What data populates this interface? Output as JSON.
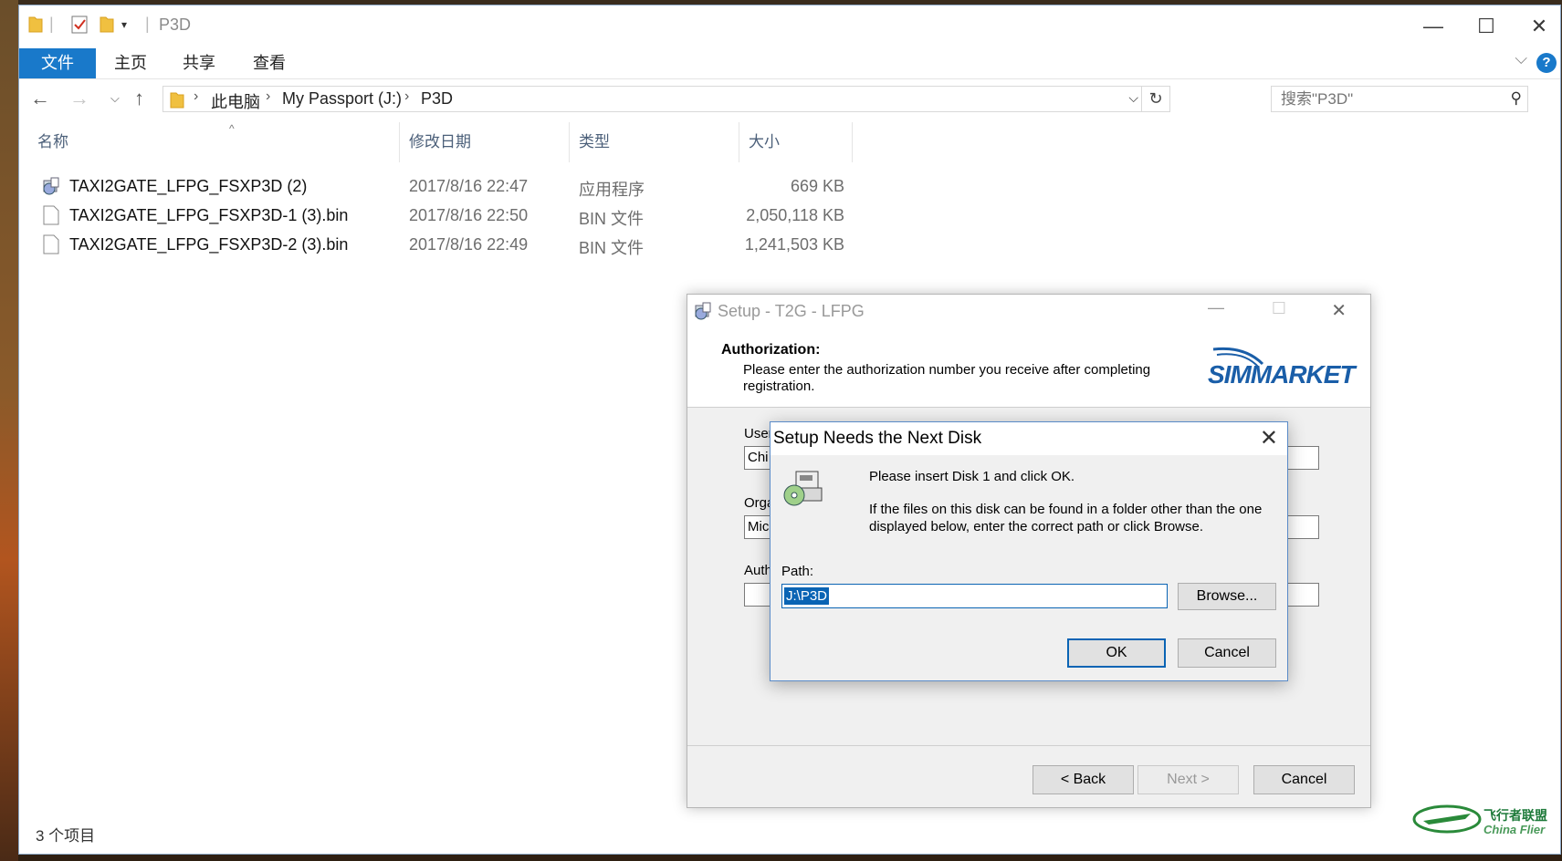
{
  "explorer": {
    "title": "P3D",
    "ribbon_tabs": [
      "文件",
      "主页",
      "共享",
      "查看"
    ],
    "breadcrumb": [
      "此电脑",
      "My Passport (J:)",
      "P3D"
    ],
    "search_placeholder": "搜索\"P3D\"",
    "columns": [
      "名称",
      "修改日期",
      "类型",
      "大小"
    ],
    "files": [
      {
        "name": "TAXI2GATE_LFPG_FSXP3D (2)",
        "date": "2017/8/16 22:47",
        "type": "应用程序",
        "size": "669 KB",
        "icon": "setup-app-icon"
      },
      {
        "name": "TAXI2GATE_LFPG_FSXP3D-1 (3).bin",
        "date": "2017/8/16 22:50",
        "type": "BIN 文件",
        "size": "2,050,118 KB",
        "icon": "file-icon"
      },
      {
        "name": "TAXI2GATE_LFPG_FSXP3D-2 (3).bin",
        "date": "2017/8/16 22:49",
        "type": "BIN 文件",
        "size": "1,241,503 KB",
        "icon": "file-icon"
      }
    ],
    "status": "3 个项目",
    "accent": "#1979ca"
  },
  "setup": {
    "title": "Setup - T2G - LFPG",
    "heading": "Authorization:",
    "description": "Please enter the authorization number you receive after completing registration.",
    "logo": "SIMMARKET",
    "fields": [
      {
        "label": "User",
        "value": "Chi"
      },
      {
        "label": "Orga",
        "value": "Mic"
      },
      {
        "label": "Auth",
        "value": ""
      }
    ],
    "buttons": {
      "back": "< Back",
      "next": "Next >",
      "cancel": "Cancel"
    }
  },
  "modal": {
    "title": "Setup Needs the Next Disk",
    "line1": "Please insert Disk 1 and click OK.",
    "line2": "If the files on this disk can be found in a folder other than the one displayed below, enter the correct path or click Browse.",
    "path_label": "Path:",
    "path_value": "J:\\P3D",
    "buttons": {
      "browse": "Browse...",
      "ok": "OK",
      "cancel": "Cancel"
    }
  },
  "watermark": {
    "cn": "飞行者联盟",
    "en": "China Flier"
  }
}
